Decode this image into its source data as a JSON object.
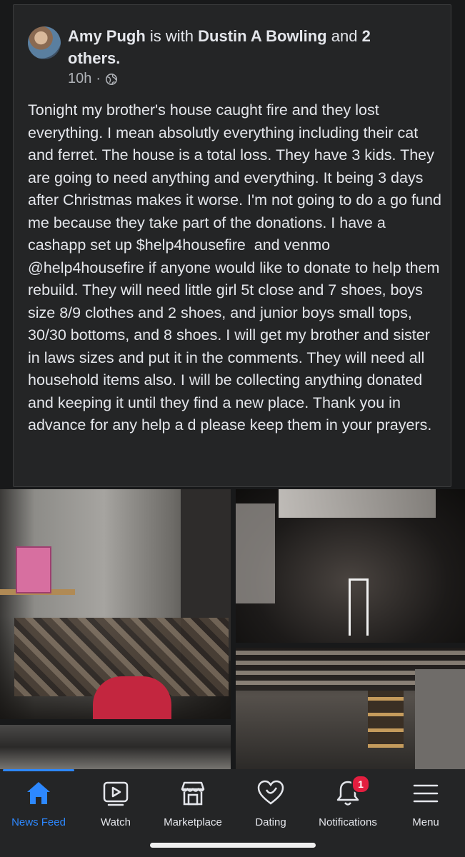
{
  "post": {
    "author": "Amy Pugh",
    "with_text": " is with ",
    "tagged": "Dustin A Bowling",
    "and_text": " and ",
    "others": "2 others.",
    "time": "10h",
    "time_sep": "·",
    "privacy_icon": "globe-icon",
    "body": "Tonight my brother's house caught fire and they lost everything. I mean absolutly everything including their cat and ferret. The house is a total loss. They have 3 kids. They are going to need anything and everything. It being 3 days after Christmas makes it worse. I'm not going to do a go fund me because they take part of the donations. I have a cashapp set up $help4housefire  and venmo  @help4housefire if anyone would like to donate to help them rebuild. They will need little girl 5t close and 7 shoes, boys size 8/9 clothes and 2 shoes, and junior boys small tops, 30/30 bottoms, and 8 shoes. I will get my brother and sister in laws sizes and put it in the comments. They will need all household items also. I will be collecting anything donated and keeping it until they find a new place. Thank you in advance for any help a d please keep them in your prayers."
  },
  "nav": {
    "active_color": "#2d88ff",
    "tabs": [
      {
        "label": "News Feed",
        "icon": "home-icon"
      },
      {
        "label": "Watch",
        "icon": "watch-icon"
      },
      {
        "label": "Marketplace",
        "icon": "marketplace-icon"
      },
      {
        "label": "Dating",
        "icon": "dating-icon"
      },
      {
        "label": "Notifications",
        "icon": "bell-icon",
        "badge": "1"
      },
      {
        "label": "Menu",
        "icon": "menu-icon"
      }
    ]
  }
}
